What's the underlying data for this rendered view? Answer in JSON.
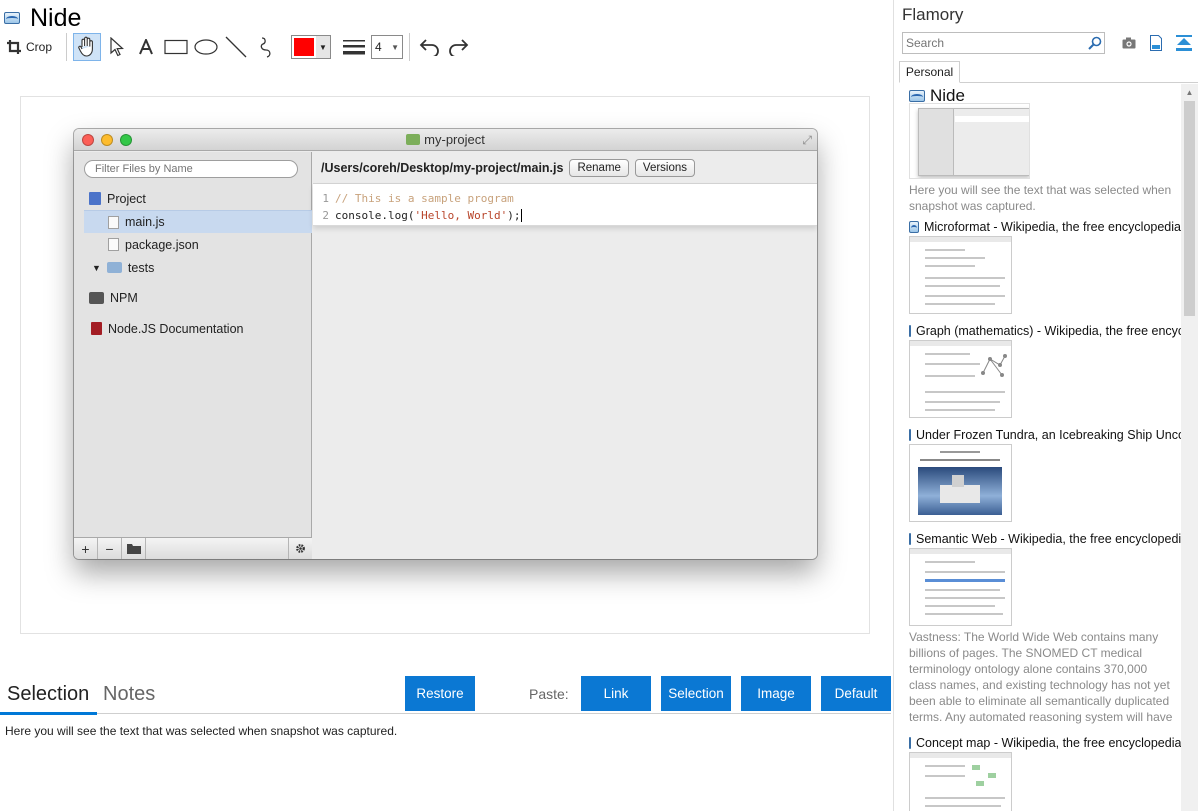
{
  "document": {
    "title": "Nide"
  },
  "toolbar": {
    "crop_label": "Crop",
    "stroke_color": "#ff0000",
    "line_width": "4",
    "tools": [
      "hand-icon",
      "pointer-icon",
      "text-icon",
      "rectangle-icon",
      "ellipse-icon",
      "line-icon",
      "freehand-icon"
    ]
  },
  "snapshot": {
    "window_title": "my-project",
    "filter_placeholder": "Filter Files by Name",
    "tree": {
      "project": "Project",
      "main_js": "main.js",
      "package_json": "package.json",
      "tests": "tests",
      "npm": "NPM",
      "docs": "Node.JS Documentation"
    },
    "path": "/Users/coreh/Desktop/my-project/main.js",
    "rename_label": "Rename",
    "versions_label": "Versions",
    "code": {
      "line1_num": "1",
      "line1": "// This is a sample program",
      "line2_num": "2",
      "line2_prefix": "console.log(",
      "line2_string": "'Hello, World'",
      "line2_suffix": ");"
    },
    "footer": {
      "add": "+",
      "remove": "−"
    }
  },
  "bottom": {
    "tab_selection": "Selection",
    "tab_notes": "Notes",
    "restore_label": "Restore",
    "paste_label": "Paste:",
    "link_label": "Link",
    "selection_label": "Selection",
    "image_label": "Image",
    "default_label": "Default",
    "selection_text": "Here you will see the text that was selected when snapshot was captured."
  },
  "sidebar": {
    "app_title": "Flamory",
    "search_placeholder": "Search",
    "tab_personal": "Personal",
    "items": [
      {
        "title": "Nide",
        "description": "Here you will see the text that was selected when snapshot was captured."
      },
      {
        "title": "Microformat - Wikipedia, the free encyclopedia",
        "description": ""
      },
      {
        "title": "Graph (mathematics) - Wikipedia, the free encyclopedia",
        "description": ""
      },
      {
        "title": "Under Frozen Tundra, an Icebreaking Ship Uncovers",
        "description": ""
      },
      {
        "title": "Semantic Web - Wikipedia, the free encyclopedia",
        "description": "Vastness: The World Wide Web contains many billions of pages. The SNOMED CT medical terminology ontology alone contains 370,000 class names, and existing technology has not yet been able to eliminate all semantically duplicated terms. Any automated reasoning system will have to deal with truly huge inputs."
      },
      {
        "title": "Concept map - Wikipedia, the free encyclopedia",
        "description": ""
      }
    ]
  }
}
